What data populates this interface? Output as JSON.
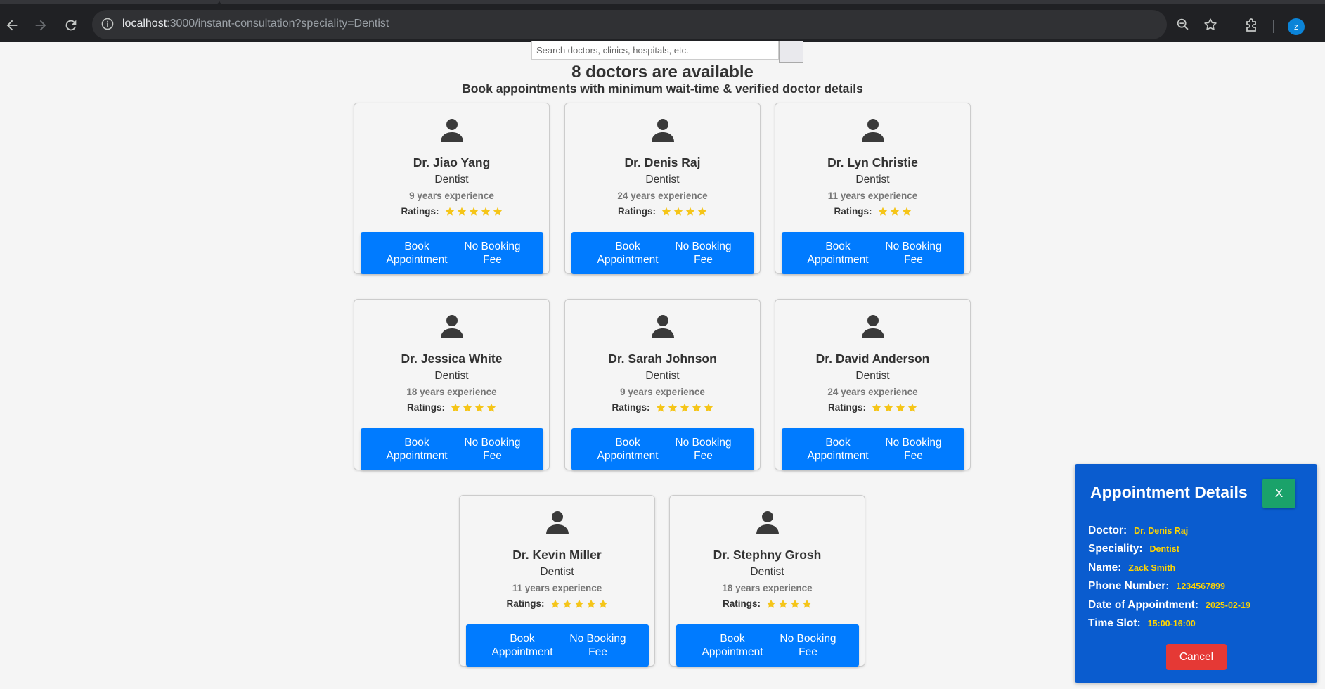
{
  "browser": {
    "url_host": "localhost",
    "url_rest": ":3000/instant-consultation?speciality=Dentist",
    "profile_initial": "z"
  },
  "search": {
    "placeholder": "Search doctors, clinics, hospitals, etc."
  },
  "heading": {
    "count_text": "8 doctors are available",
    "subtitle": "Book appointments with minimum wait-time & verified doctor details"
  },
  "labels": {
    "ratings": "Ratings:",
    "book_line1": "Book",
    "book_line2": "Appointment",
    "fee_line1": "No Booking",
    "fee_line2": "Fee"
  },
  "doctors": [
    {
      "name": "Dr. Jiao Yang",
      "speciality": "Dentist",
      "experience": "9 years experience",
      "stars": 5
    },
    {
      "name": "Dr. Denis Raj",
      "speciality": "Dentist",
      "experience": "24 years experience",
      "stars": 4
    },
    {
      "name": "Dr. Lyn Christie",
      "speciality": "Dentist",
      "experience": "11 years experience",
      "stars": 3
    },
    {
      "name": "Dr. Jessica White",
      "speciality": "Dentist",
      "experience": "18 years experience",
      "stars": 4
    },
    {
      "name": "Dr. Sarah Johnson",
      "speciality": "Dentist",
      "experience": "9 years experience",
      "stars": 5
    },
    {
      "name": "Dr. David Anderson",
      "speciality": "Dentist",
      "experience": "24 years experience",
      "stars": 4
    },
    {
      "name": "Dr. Kevin Miller",
      "speciality": "Dentist",
      "experience": "11 years experience",
      "stars": 5
    },
    {
      "name": "Dr. Stephny Grosh",
      "speciality": "Dentist",
      "experience": "18 years experience",
      "stars": 4
    }
  ],
  "appointment": {
    "title": "Appointment Details",
    "close_label": "X",
    "doctor_label": "Doctor:",
    "doctor": "Dr. Denis Raj",
    "speciality_label": "Speciality:",
    "speciality": "Dentist",
    "name_label": "Name:",
    "name": "Zack Smith",
    "phone_label": "Phone Number:",
    "phone": "1234567899",
    "date_label": "Date of Appointment:",
    "date": "2025-02-19",
    "slot_label": "Time Slot:",
    "slot": "15:00-16:00",
    "cancel_label": "Cancel"
  },
  "colors": {
    "primary_button": "#007bff",
    "panel": "#0a5ccf",
    "star": "#f5c518",
    "highlight": "#ffd400",
    "cancel": "#e53935",
    "close": "#1aa26a"
  }
}
